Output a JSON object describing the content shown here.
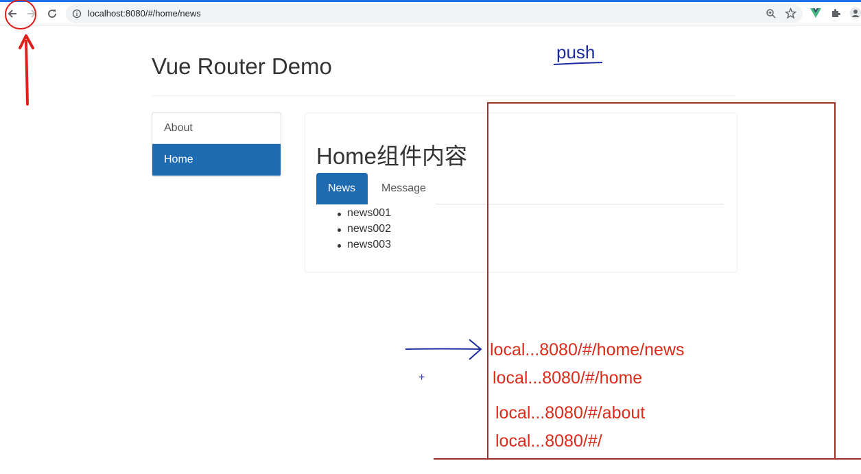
{
  "browser": {
    "url": "localhost:8080/#/home/news",
    "icons": [
      "back-arrow-icon",
      "forward-arrow-icon",
      "reload-icon",
      "info-icon",
      "zoom-icon",
      "star-icon",
      "vue-devtools-icon",
      "extensions-puzzle-icon",
      "profile-icon"
    ]
  },
  "page": {
    "title": "Vue Router Demo",
    "nav": [
      {
        "label": "About",
        "active": false
      },
      {
        "label": "Home",
        "active": true
      }
    ],
    "home": {
      "heading": "Home组件内容",
      "tabs": [
        {
          "label": "News",
          "active": true
        },
        {
          "label": "Message",
          "active": false
        }
      ],
      "news": [
        "news001",
        "news002",
        "news003"
      ]
    }
  },
  "annotation": {
    "push_label": "push",
    "plus": "+",
    "history_stack": [
      "local...8080/#/home/news",
      "local...8080/#/home",
      "local...8080/#/about",
      "local...8080/#/"
    ],
    "colors": {
      "red": "#d92c1b",
      "box": "#9c3128",
      "blue": "#1b2a9e"
    }
  },
  "theme": {
    "primary": "#1f6bb1"
  }
}
